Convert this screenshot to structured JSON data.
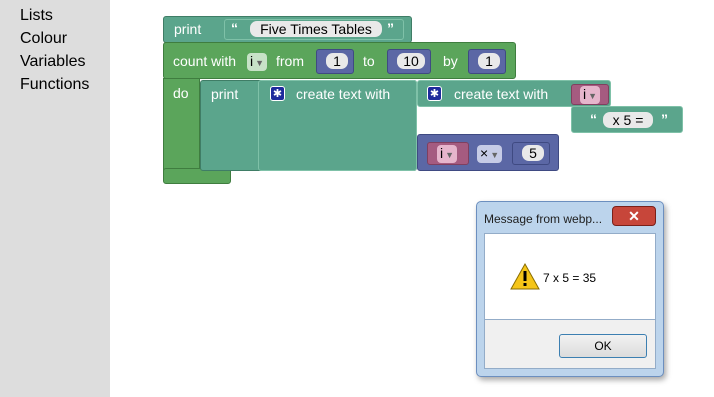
{
  "toolbox": {
    "items": [
      "Lists",
      "Colour",
      "Variables",
      "Functions"
    ]
  },
  "blocks": {
    "outer_print": {
      "label": "print",
      "quote_open": "“",
      "text_value": "Five Times Tables",
      "quote_close": "”"
    },
    "count": {
      "label": "count with",
      "var": "i",
      "from_label": "from",
      "from_value": "1",
      "to_label": "to",
      "to_value": "10",
      "by_label": "by",
      "by_value": "1",
      "do_label": "do"
    },
    "inner_print": {
      "label": "print"
    },
    "create_text_1": {
      "label": "create text with"
    },
    "create_text_2": {
      "label": "create text with",
      "var": "i",
      "quote_open": "“",
      "text_value": "x 5 =",
      "quote_close": "”"
    },
    "multiply": {
      "var": "i",
      "operator": "×",
      "value": "5"
    }
  },
  "dialog": {
    "title": "Message from webp...",
    "close_symbol": "✕",
    "message": "7 x 5 = 35",
    "ok_label": "OK"
  },
  "colors": {
    "loop_green": "#5ba55b",
    "text_teal": "#5ba58c",
    "math_blue": "#5b67a5",
    "variable_pink": "#a55b80",
    "toolbox_gray": "#dddddd"
  },
  "icons": [
    "gear-icon",
    "warning-icon",
    "dropdown-arrow-icon",
    "close-icon"
  ]
}
